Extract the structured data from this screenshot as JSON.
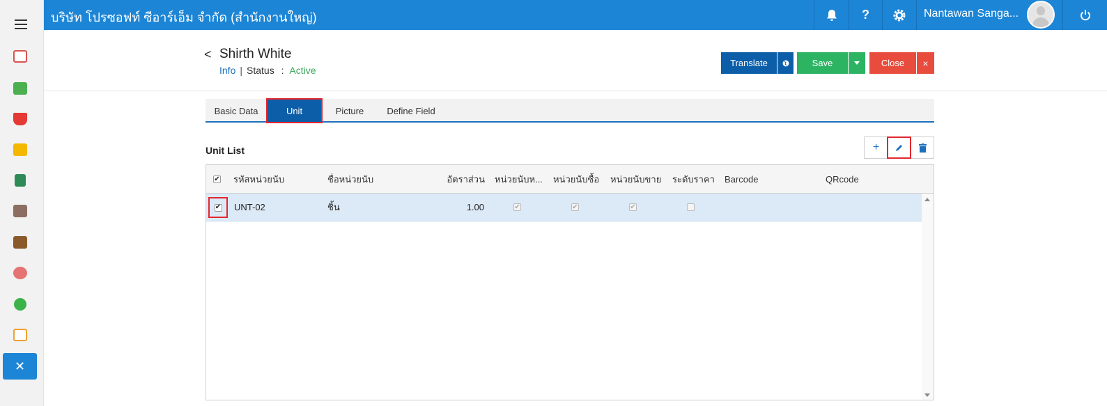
{
  "topbar": {
    "company": "บริษัท โปรซอฟท์ ซีอาร์เอ็ม จำกัด (สำนักงานใหญ่)",
    "user_name": "Nantawan Sanga...",
    "icons": [
      "bell-icon",
      "help-icon",
      "gear-icon",
      "power-icon"
    ],
    "help_glyph": "?"
  },
  "sidebar": {
    "items": [
      {
        "name": "dashboard-icon",
        "color": "#d9534f"
      },
      {
        "name": "money-icon",
        "color": "#4caf50"
      },
      {
        "name": "cart-icon",
        "color": "#e53935"
      },
      {
        "name": "box-icon",
        "color": "#f5b800"
      },
      {
        "name": "book-icon",
        "color": "#2e8b57"
      },
      {
        "name": "bank-icon",
        "color": "#8d6e63"
      },
      {
        "name": "wallet-icon",
        "color": "#8b5a2b"
      },
      {
        "name": "user-support-icon",
        "color": "#e57373"
      },
      {
        "name": "check-circle-icon",
        "color": "#3cb34a"
      },
      {
        "name": "report-icon",
        "color": "#f0a030"
      },
      {
        "name": "tools-icon",
        "color": "#1c85d6"
      }
    ]
  },
  "header": {
    "title": "Shirth White",
    "info_label": "Info",
    "separator": "|",
    "status_label": "Status",
    "status_colon": ":",
    "status_value": "Active",
    "back_glyph": "<"
  },
  "actions": {
    "translate_label": "Translate",
    "save_label": "Save",
    "close_label": "Close",
    "close_x": "×",
    "colors": {
      "primary": "#0d5ea8",
      "save": "#2cb463",
      "close": "#e84c3d"
    }
  },
  "tabs": [
    {
      "label": "Basic Data",
      "active": false
    },
    {
      "label": "Unit",
      "active": true
    },
    {
      "label": "Picture",
      "active": false
    },
    {
      "label": "Define Field",
      "active": false
    }
  ],
  "unit_list": {
    "title": "Unit List",
    "tools": {
      "add": "+",
      "edit": "edit-icon",
      "delete": "trash-icon"
    },
    "columns": [
      "รหัสหน่วยนับ",
      "ชื่อหน่วยนับ",
      "อัตราส่วน",
      "หน่วยนับห...",
      "หน่วยนับซื้อ",
      "หน่วยนับขาย",
      "ระดับราคา",
      "Barcode",
      "QRcode"
    ],
    "rows": [
      {
        "selected": true,
        "code": "UNT-02",
        "name": "ชิ้น",
        "ratio": "1.00",
        "base_unit": true,
        "purchase_unit": true,
        "sale_unit": true,
        "price_level": false,
        "barcode": "",
        "qrcode": ""
      }
    ]
  }
}
